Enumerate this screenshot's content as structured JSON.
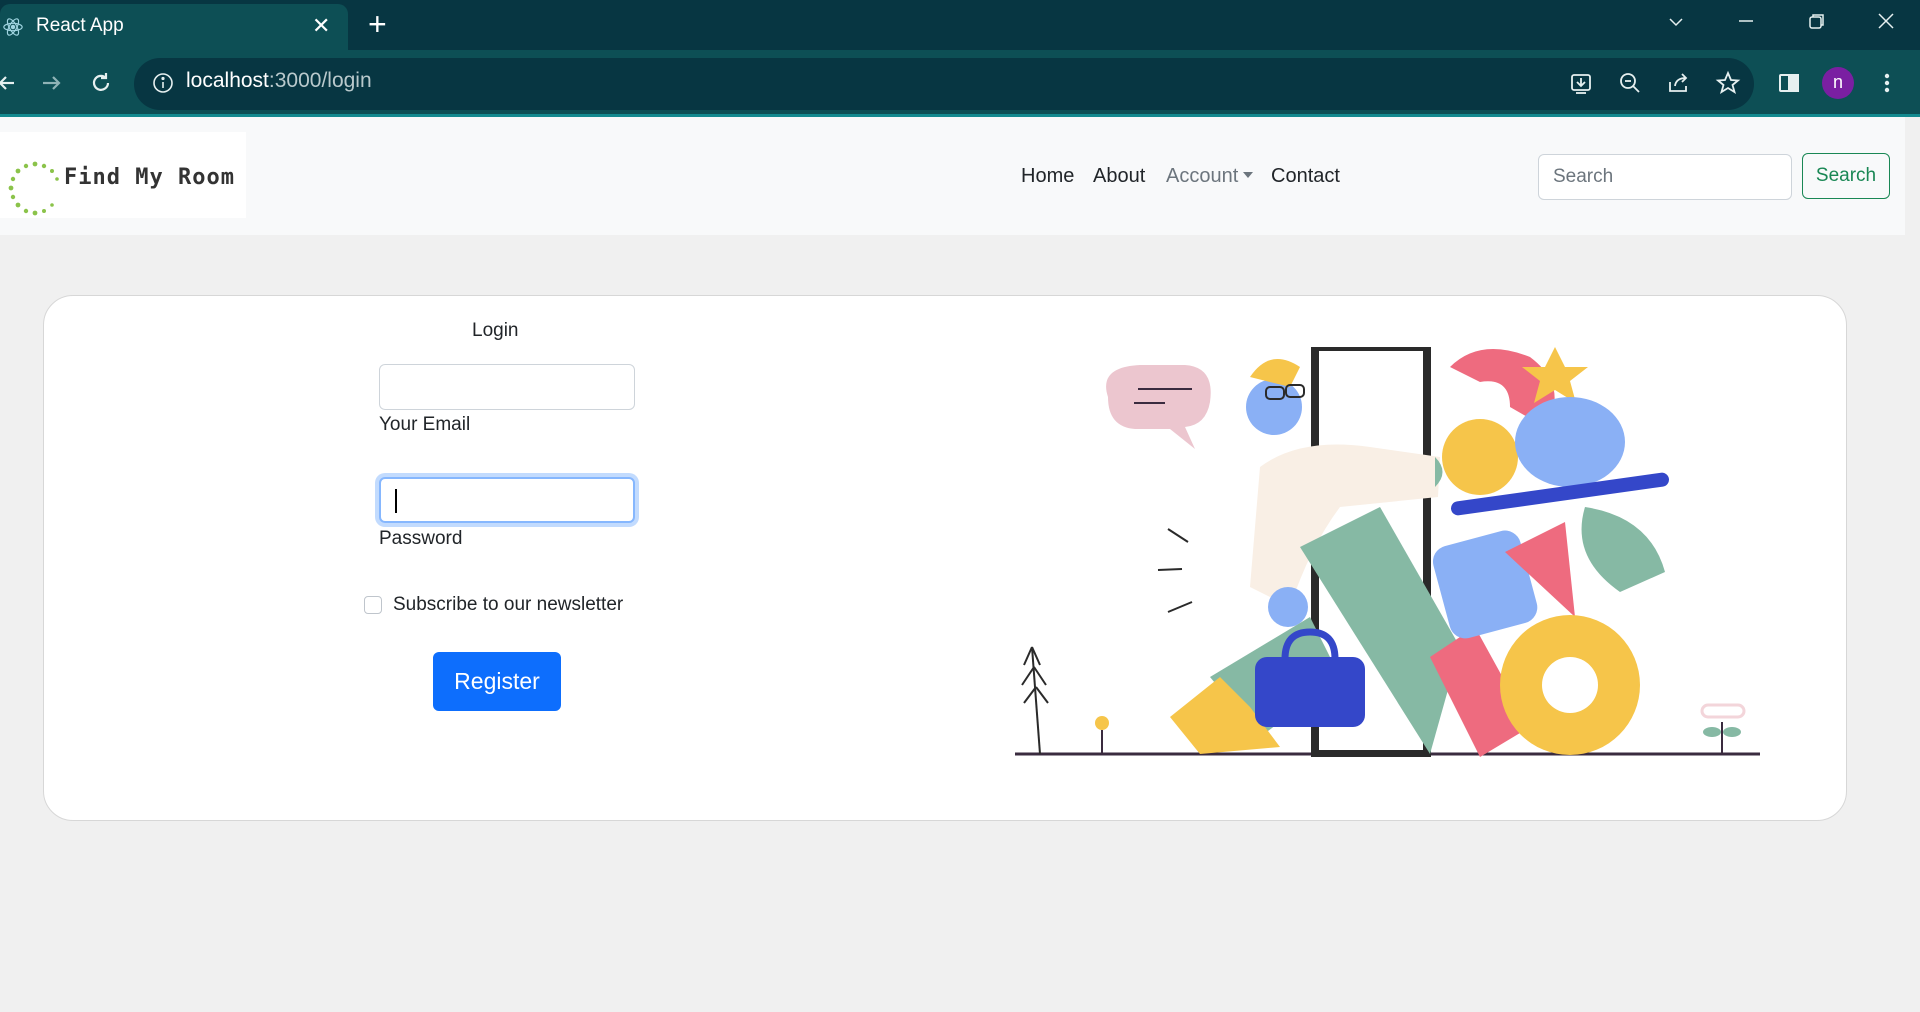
{
  "browser": {
    "tab_title": "React App",
    "url_host": "localhost",
    "url_rest": ":3000/login",
    "profile_initial": "n"
  },
  "site": {
    "logo_text": "Find My Room",
    "nav": {
      "home": "Home",
      "about": "About",
      "account": "Account",
      "contact": "Contact"
    },
    "search": {
      "placeholder": "Search",
      "button": "Search"
    }
  },
  "login": {
    "title": "Login",
    "email_label": "Your Email",
    "password_label": "Password",
    "newsletter_label": "Subscribe to our newsletter",
    "register_button": "Register"
  },
  "colors": {
    "browser_frame": "#073642",
    "browser_tab": "#0d4f55",
    "primary": "#0d6efd",
    "success": "#198754"
  }
}
